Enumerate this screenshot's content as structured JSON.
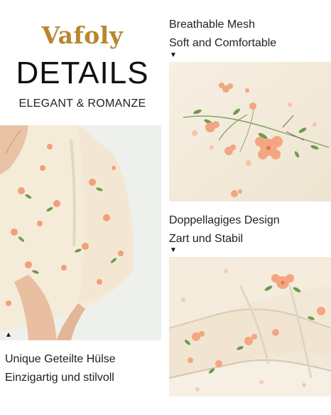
{
  "brand": "Vafoly",
  "title": "DETAILS",
  "subtitle": "ELEGANT & ROMANZE",
  "captions": {
    "right_top": [
      "Breathable Mesh",
      "Soft and Comfortable"
    ],
    "right_bottom": [
      "Doppellagiges Design",
      "Zart und Stabil"
    ],
    "left": [
      "Unique Geteilte Hülse",
      "Einzigartig und stilvoll"
    ]
  },
  "arrows": {
    "down": "▼",
    "up": "▲"
  },
  "colors": {
    "brand_gold": "#b8862e",
    "fabric_cream": "#f4ecdd",
    "flower_peach": "#f0a07a",
    "leaf_green": "#6f9a4e"
  }
}
